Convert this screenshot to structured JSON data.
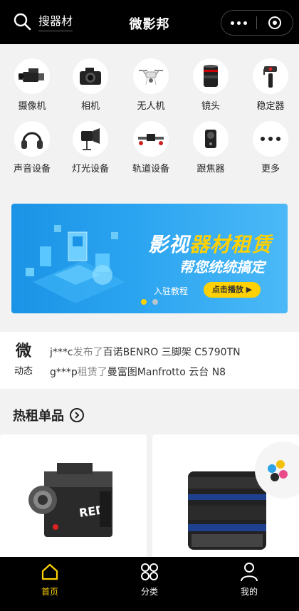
{
  "header": {
    "search_text": "搜器材",
    "title": "微影邦"
  },
  "categories": [
    {
      "label": "摄像机",
      "icon": "video-camera-icon"
    },
    {
      "label": "相机",
      "icon": "camera-icon"
    },
    {
      "label": "无人机",
      "icon": "drone-icon"
    },
    {
      "label": "镜头",
      "icon": "lens-icon"
    },
    {
      "label": "稳定器",
      "icon": "gimbal-icon"
    },
    {
      "label": "声音设备",
      "icon": "headphones-icon"
    },
    {
      "label": "灯光设备",
      "icon": "light-icon"
    },
    {
      "label": "轨道设备",
      "icon": "slider-rail-icon"
    },
    {
      "label": "跟焦器",
      "icon": "follow-focus-icon"
    },
    {
      "label": "更多",
      "icon": "more-dots-icon"
    }
  ],
  "banner": {
    "title_a": "影视",
    "title_b": "器材租赁",
    "subtitle": "帮您统统搞定",
    "link_text": "入驻教程",
    "button": "点击播放 ▶",
    "slide_count": 2,
    "active_slide": 1
  },
  "news": {
    "logo_big": "微",
    "logo_small": "动态",
    "lines": [
      {
        "user": "j***c",
        "action": "发布了",
        "item": "百诺BENRO 三脚架 C5790TN"
      },
      {
        "user": "g***p",
        "action": "租赁了",
        "item": "曼富图Manfrotto 云台 N8"
      }
    ]
  },
  "hot": {
    "title": "热租单品"
  },
  "products": [
    {
      "name": "RED cinema camera"
    },
    {
      "name": "Cine lens"
    }
  ],
  "tabs": [
    {
      "label": "首页",
      "icon": "home-icon",
      "active": true
    },
    {
      "label": "分类",
      "icon": "grid-icon",
      "active": false
    },
    {
      "label": "我的",
      "icon": "user-icon",
      "active": false
    }
  ],
  "colors": {
    "accent": "#ffd100",
    "header_bg": "#000000",
    "tab_active": "#ffd100",
    "tab_inactive": "#ffffff"
  }
}
